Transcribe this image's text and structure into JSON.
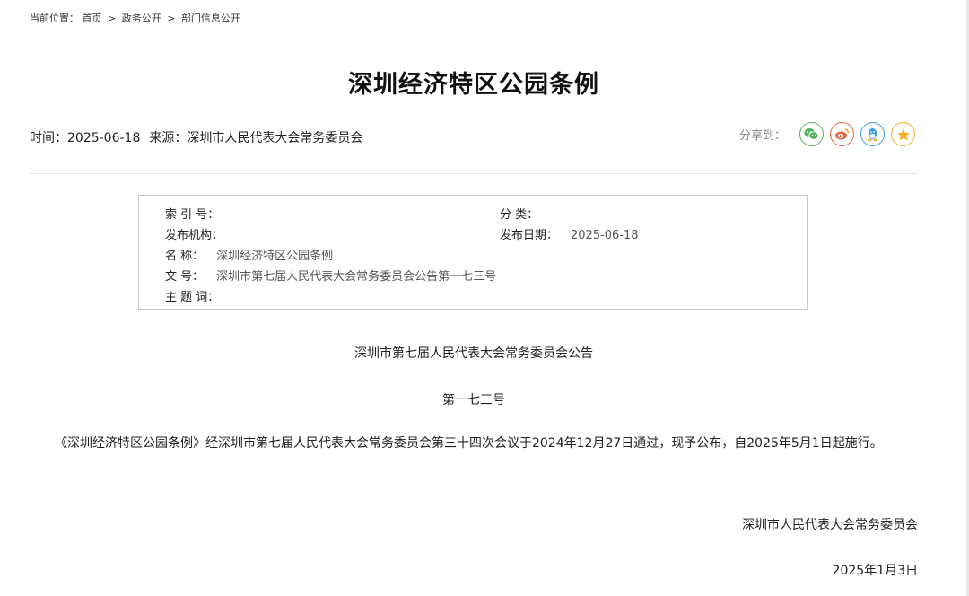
{
  "breadcrumb": {
    "prefix": "当前位置：",
    "items": [
      "首页",
      "政务公开",
      "部门信息公开"
    ],
    "separator": ">"
  },
  "article": {
    "title": "深圳经济特区公园条例",
    "time_label": "时间：",
    "time_value": "2025-06-18",
    "source_label": "来源：",
    "source_value": "深圳市人民代表大会常务委员会"
  },
  "share": {
    "label": "分享到：",
    "icons": [
      "wechat-icon",
      "weibo-icon",
      "qq-icon",
      "qzone-icon"
    ]
  },
  "info": {
    "index_label": "索 引 号：",
    "index_value": "",
    "category_label": "分 类：",
    "category_value": "",
    "publisher_label": "发布机构：",
    "publisher_value": "",
    "date_label": "发布日期：",
    "date_value": "2025-06-18",
    "name_label": "名 称：",
    "name_value": "深圳经济特区公园条例",
    "docno_label": "文 号：",
    "docno_value": "深圳市第七届人民代表大会常务委员会公告第一七三号",
    "keywords_label": "主 题 词：",
    "keywords_value": ""
  },
  "body": {
    "notice_title": "深圳市第七届人民代表大会常务委员会公告",
    "notice_number": "第一七三号",
    "paragraph": "《深圳经济特区公园条例》经深圳市第七届人民代表大会常务委员会第三十四次会议于2024年12月27日通过，现予公布，自2025年5月1日起施行。",
    "signer": "深圳市人民代表大会常务委员会",
    "date": "2025年1月3日"
  },
  "colors": {
    "wechat": "#51b35b",
    "weibo": "#e5643c",
    "qq": "#3a9be3",
    "qzone": "#f0b22a",
    "divider": "#dfe6ee"
  }
}
